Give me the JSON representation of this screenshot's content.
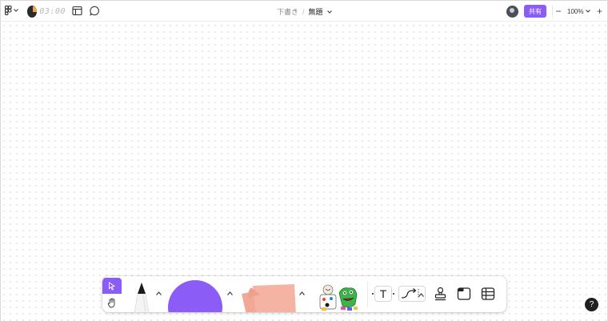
{
  "header": {
    "timer": "03:00",
    "breadcrumb": "下書き",
    "separator": "/",
    "doc_title": "無題",
    "share_label": "共有",
    "zoom_label": "100%",
    "zoom_minus": "−",
    "zoom_plus": "+"
  },
  "toolbar": {
    "text_tool_glyph": "T"
  },
  "help_label": "?",
  "colors": {
    "accent": "#8b5cf6",
    "sticky": "#f5b3a4",
    "help_bg": "#1f1f1f"
  },
  "icons": {
    "logo": "figjam-logo-icon",
    "timer": "timer-icon",
    "layout": "layout-icon",
    "comment": "comment-icon",
    "select": "cursor-icon",
    "hand": "hand-icon",
    "pen": "marker-icon",
    "shape": "circle-shape-icon",
    "sticky": "sticky-note-icon",
    "stickers": "stickers-icon",
    "text": "text-icon",
    "connector": "connector-icon",
    "stamp": "stamp-icon",
    "section": "section-icon",
    "table": "table-icon"
  }
}
